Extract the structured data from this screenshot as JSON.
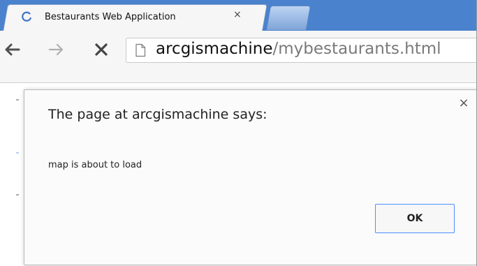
{
  "browser": {
    "tab": {
      "title": "Bestaurants Web Application",
      "close_glyph": "×",
      "favicon": "loading-spinner-icon"
    },
    "new_tab_icon": "new-tab-icon",
    "toolbar": {
      "back_icon": "back-arrow-icon",
      "forward_icon": "forward-arrow-icon",
      "stop_icon": "stop-icon"
    },
    "omnibox": {
      "page_icon": "page-icon",
      "url_host": "arcgismachine",
      "url_path": "/mybestaurants.html"
    }
  },
  "dialog": {
    "title": "The page at arcgismachine says:",
    "message": "map is about to load",
    "close_glyph": "×",
    "ok_label": "OK"
  },
  "colors": {
    "tabstrip": "#4a82cd",
    "ok_border": "#4d90fe",
    "url_path": "#7a7a7a"
  }
}
